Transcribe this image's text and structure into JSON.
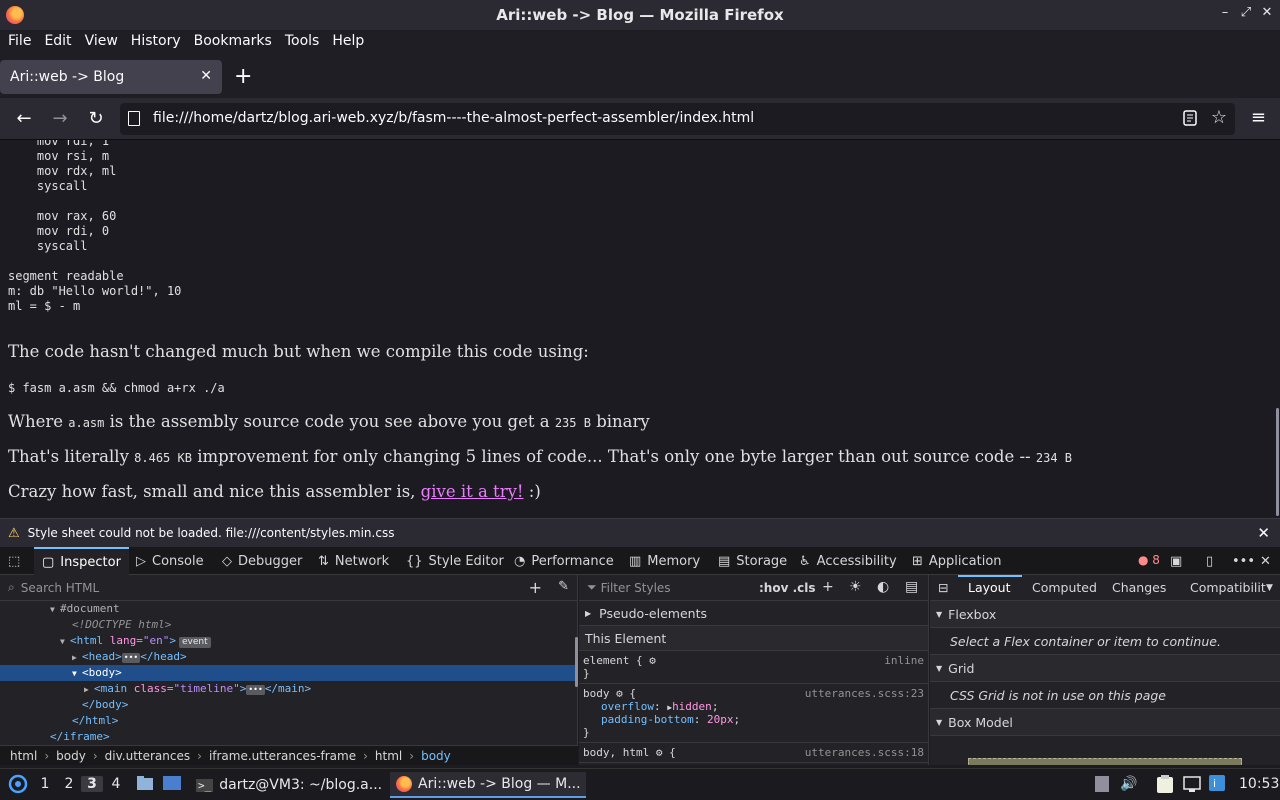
{
  "window": {
    "title": "Ari::web -> Blog — Mozilla Firefox",
    "controls": [
      "–",
      "⤢",
      "✕"
    ]
  },
  "menubar": [
    {
      "label": "File"
    },
    {
      "label": "Edit"
    },
    {
      "label": "View"
    },
    {
      "label": "History"
    },
    {
      "label": "Bookmarks"
    },
    {
      "label": "Tools"
    },
    {
      "label": "Help"
    }
  ],
  "tab": {
    "title": "Ari::web -> Blog",
    "close": "✕",
    "new": "+"
  },
  "nav": {
    "back": "←",
    "forward": "→",
    "reload": "↻",
    "url": "file:///home/dartz/blog.ari-web.xyz/b/fasm----the-almost-perfect-assembler/index.html",
    "menu": "≡"
  },
  "page": {
    "code1": "    mov rdi, 1\n    mov rsi, m\n    mov rdx, ml\n    syscall\n\n    mov rax, 60\n    mov rdi, 0\n    syscall\n\nsegment readable\nm: db \"Hello world!\", 10\nml = $ - m",
    "p1": "The code hasn't changed much but when we compile this code using:",
    "cmd": "$ fasm a.asm && chmod a+rx ./a",
    "p2a": "Where ",
    "p2code": "a.asm",
    "p2b": " is the assembly source code you see above you get a ",
    "p2size": "235 B",
    "p2c": " binary",
    "p3a": "That's literally ",
    "p3size": "8.465 KB",
    "p3b": " improvement for only changing 5 lines of code... That's only one byte larger than out source code -- ",
    "p3size2": "234 B",
    "p4a": "Crazy how fast, small and nice this assembler is, ",
    "p4link": "give it a try!",
    "p4b": " :)"
  },
  "warning": {
    "text": "Style sheet could not be loaded. file:///content/styles.min.css",
    "close": "✕"
  },
  "devtools": {
    "tabs": [
      {
        "label": "Inspector",
        "icon": "▢"
      },
      {
        "label": "Console",
        "icon": "▷"
      },
      {
        "label": "Debugger",
        "icon": "◇"
      },
      {
        "label": "Network",
        "icon": "⇅"
      },
      {
        "label": "Style Editor",
        "icon": "{}"
      },
      {
        "label": "Performance",
        "icon": "◔"
      },
      {
        "label": "Memory",
        "icon": "▥"
      },
      {
        "label": "Storage",
        "icon": "▤"
      },
      {
        "label": "Accessibility",
        "icon": "♿"
      },
      {
        "label": "Application",
        "icon": "⊞"
      }
    ],
    "error_count": "8",
    "search_placeholder": "Search HTML",
    "tree": {
      "document": "#document",
      "doctype": "<!DOCTYPE html>",
      "html_open": "<html",
      "html_attr": "lang",
      "html_val": "\"en\"",
      "event": "event",
      "head": "<head>",
      "head_close": "</head>",
      "body": "<body>",
      "main_open": "<main",
      "main_attr": "class",
      "main_val": "\"timeline\"",
      "main_close": "</main>",
      "body_close": "</body>",
      "html_close": "</html>",
      "iframe_close": "</iframe>"
    },
    "breadcrumbs": [
      "html",
      "body",
      "div.utterances",
      "iframe.utterances-frame",
      "html",
      "body"
    ],
    "rules": {
      "filter_placeholder": "Filter Styles",
      "hov": ":hov .cls",
      "pseudo": "Pseudo-elements",
      "this_element": "This Element",
      "element_sel": "element {",
      "inline": "inline",
      "close": "}",
      "body_sel": "body",
      "body_src": "utterances.scss:23",
      "p1_name": "overflow",
      "p1_val": "hidden",
      "p2_name": "padding-bottom",
      "p2_val": "20px",
      "bodyhtml_sel": "body, html",
      "bodyhtml_src": "utterances.scss:18"
    },
    "layout": {
      "tabs": [
        "Layout",
        "Computed",
        "Changes",
        "Compatibilit"
      ],
      "flexbox": "Flexbox",
      "flex_msg": "Select a Flex container or item to continue.",
      "grid": "Grid",
      "grid_msg": "CSS Grid is not in use on this page",
      "boxmodel": "Box Model"
    }
  },
  "taskbar": {
    "workspaces": [
      "1",
      "2",
      "3",
      "4"
    ],
    "terminal": "dartz@VM3: ~/blog.a...",
    "firefox": "Ari::web -> Blog — M...",
    "clock": "10:53"
  }
}
